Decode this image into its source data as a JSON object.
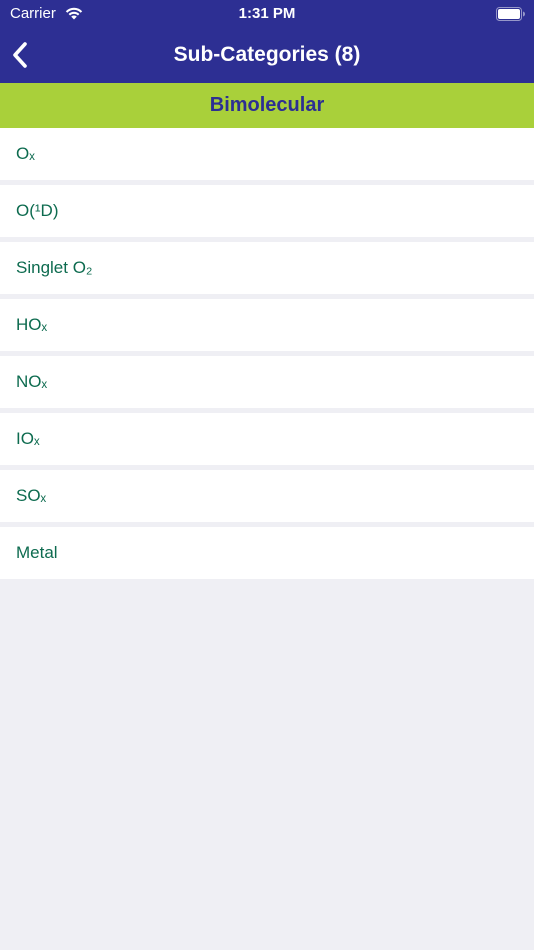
{
  "status_bar": {
    "carrier": "Carrier",
    "time": "1:31 PM",
    "icons": [
      "wifi-icon",
      "battery-icon"
    ]
  },
  "nav": {
    "back_icon": "chevron-left-icon",
    "title": "Sub-Categories (8)"
  },
  "section": {
    "title": "Bimolecular"
  },
  "items": [
    {
      "label": "Oₓ"
    },
    {
      "label": "O(¹D)"
    },
    {
      "label": "Singlet O₂"
    },
    {
      "label": "HOₓ"
    },
    {
      "label": "NOₓ"
    },
    {
      "label": "IOₓ"
    },
    {
      "label": "SOₓ"
    },
    {
      "label": "Metal"
    }
  ],
  "colors": {
    "nav_background": "#2d2f93",
    "section_background": "#a9d03a",
    "section_text": "#2d2f93",
    "item_text": "#0d6b4f",
    "page_background": "#efeff4"
  }
}
